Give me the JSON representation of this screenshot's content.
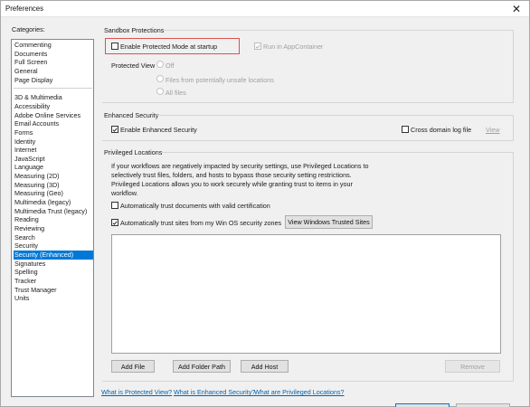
{
  "window": {
    "title": "Preferences",
    "close_glyph": "✕"
  },
  "categories": {
    "label": "Categories:",
    "group1": [
      "Commenting",
      "Documents",
      "Full Screen",
      "General",
      "Page Display"
    ],
    "group2": [
      "3D & Multimedia",
      "Accessibility",
      "Adobe Online Services",
      "Email Accounts",
      "Forms",
      "Identity",
      "Internet",
      "JavaScript",
      "Language",
      "Measuring (2D)",
      "Measuring (3D)",
      "Measuring (Geo)",
      "Multimedia (legacy)",
      "Multimedia Trust (legacy)",
      "Reading",
      "Reviewing",
      "Search",
      "Security",
      "Security (Enhanced)",
      "Signatures",
      "Spelling",
      "Tracker",
      "Trust Manager",
      "Units"
    ],
    "selected": "Security (Enhanced)"
  },
  "sandbox": {
    "title": "Sandbox Protections",
    "enable_protected_mode": "Enable Protected Mode at startup",
    "enable_protected_mode_checked": false,
    "run_in_appcontainer": "Run in AppContainer",
    "run_in_appcontainer_checked": true,
    "protected_view_label": "Protected View",
    "pv_off": "Off",
    "pv_unsafe": "Files from potentially unsafe locations",
    "pv_all": "All files"
  },
  "enhanced": {
    "title": "Enhanced Security",
    "enable_label": "Enable Enhanced Security",
    "enable_checked": true,
    "cross_domain_label": "Cross domain log file",
    "cross_domain_checked": false,
    "view_link": "View"
  },
  "privileged": {
    "title": "Privileged Locations",
    "info_lines": [
      "If your workflows are negatively impacted by security settings, use Privileged Locations to",
      "selectively trust files, folders, and hosts to bypass those security setting restrictions.",
      "Privileged Locations allows you to work securely while granting trust to items in your",
      "workflow."
    ],
    "trust_certified": "Automatically trust documents with valid certification",
    "trust_certified_checked": false,
    "trust_win_os": "Automatically trust sites from my Win OS security zones",
    "trust_win_os_checked": true,
    "view_trusted_sites_button": "View Windows Trusted Sites",
    "add_file_button": "Add File",
    "add_folder_button": "Add Folder Path",
    "add_host_button": "Add Host",
    "remove_button": "Remove"
  },
  "links": {
    "protected_view": "What is Protected View?",
    "enhanced_security": "What is Enhanced Security?",
    "privileged_locations": "What are Privileged Locations?"
  },
  "colors": {
    "selection": "#0078d7",
    "link": "#0063b1",
    "highlight_box": "#d9534f"
  }
}
